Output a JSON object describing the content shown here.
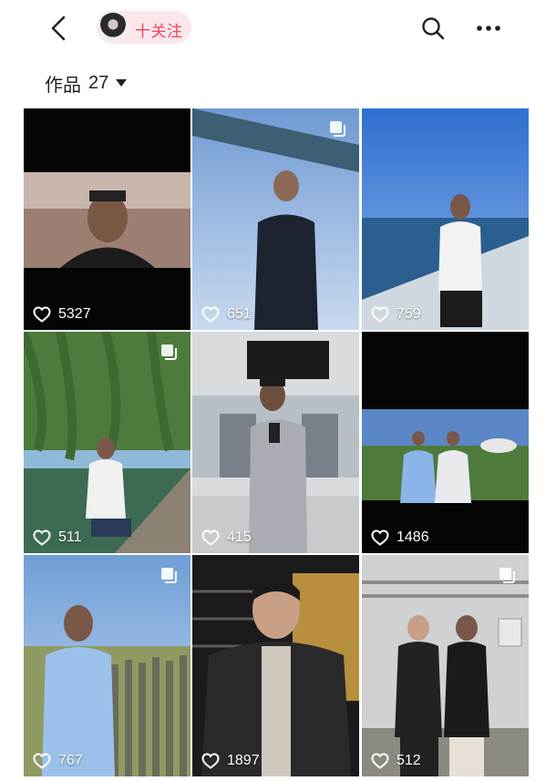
{
  "header": {
    "follow_label": "十关注",
    "icons": [
      "chevron-left-icon",
      "avatar",
      "search-icon",
      "more-icon"
    ]
  },
  "works": {
    "label": "作品",
    "count": "27"
  },
  "grid": {
    "tiles": [
      {
        "likes": "5327",
        "multi": false
      },
      {
        "likes": "651",
        "multi": true
      },
      {
        "likes": "759",
        "multi": false
      },
      {
        "likes": "511",
        "multi": true
      },
      {
        "likes": "415",
        "multi": false
      },
      {
        "likes": "1486",
        "multi": false
      },
      {
        "likes": "767",
        "multi": true
      },
      {
        "likes": "1897",
        "multi": false
      },
      {
        "likes": "512",
        "multi": true
      }
    ]
  },
  "colors": {
    "accent": "#f0435f",
    "pill_bg": "#fbe8ec",
    "text": "#222222"
  }
}
